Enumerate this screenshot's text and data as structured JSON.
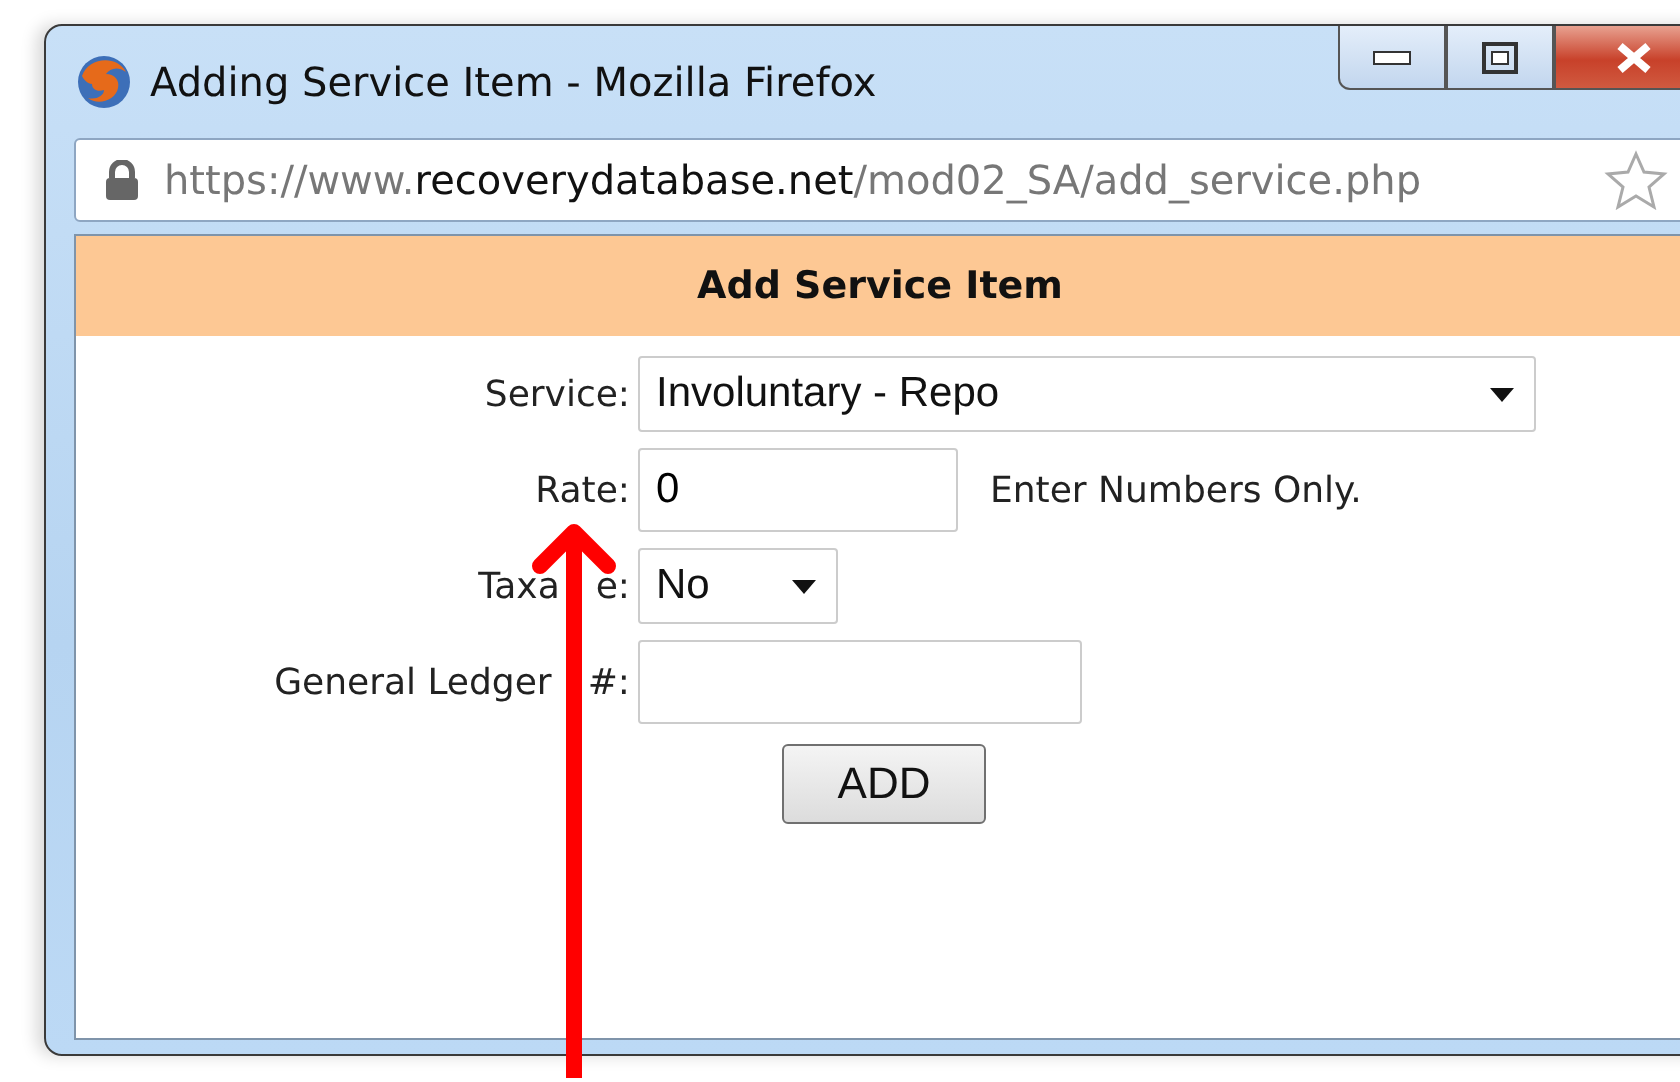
{
  "window": {
    "title": "Adding Service Item - Mozilla Firefox"
  },
  "address_bar": {
    "url_prefix": "https://www.",
    "url_domain": "recoverydatabase.net",
    "url_path": "/mod02_SA/add_service.php"
  },
  "form": {
    "heading": "Add Service Item",
    "fields": [
      {
        "kind": "select",
        "label": [
          "Service:"
        ],
        "value": "Involuntary - Repo"
      },
      {
        "kind": "text",
        "label": [
          "Rate:"
        ],
        "value": "0",
        "hint": "Enter Numbers Only."
      },
      {
        "kind": "select",
        "label": [
          "Taxa",
          "e:"
        ],
        "value": "No"
      },
      {
        "kind": "text",
        "label": [
          "General Ledger",
          "#:"
        ]
      }
    ],
    "button": "ADD"
  }
}
